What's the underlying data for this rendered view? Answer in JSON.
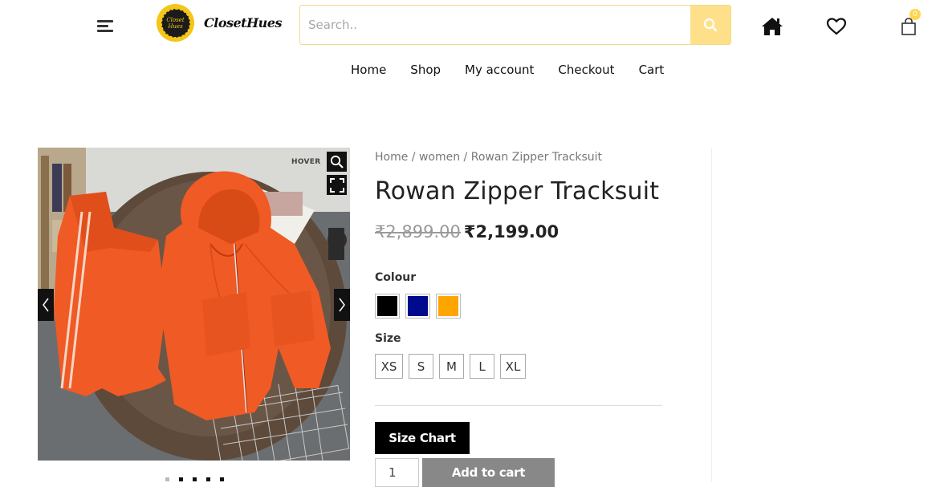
{
  "header": {
    "logo_badge_text": "Closet Hues",
    "logo_text": "ClosetHues",
    "search_placeholder": "Search..",
    "cart_count": "0"
  },
  "nav": {
    "items": [
      {
        "label": "Home"
      },
      {
        "label": "Shop"
      },
      {
        "label": "My account"
      },
      {
        "label": "Checkout"
      },
      {
        "label": "Cart"
      }
    ]
  },
  "gallery": {
    "hover_label": "HOVER",
    "image_subject": "orange zip-up hoodie and jogger tracksuit laid flat",
    "slides_total": 5,
    "active_slide": 1
  },
  "product": {
    "breadcrumb": {
      "home": "Home",
      "sep1": " / ",
      "category": "women",
      "sep2": " / ",
      "current": "Rowan Zipper Tracksuit"
    },
    "title": "Rowan Zipper Tracksuit",
    "price_old": "₹2,899.00",
    "price_new": "₹2,199.00",
    "colour_label": "Colour",
    "colours": [
      "#000000",
      "#000a8c",
      "#ffa500"
    ],
    "size_label": "Size",
    "sizes": [
      "XS",
      "S",
      "M",
      "L",
      "XL"
    ],
    "size_chart_label": "Size Chart",
    "quantity": "1",
    "add_to_cart_label": "Add to cart"
  },
  "colors": {
    "accent_yellow": "#ffe08a",
    "button_dark": "#000000",
    "button_disabled": "#888888"
  }
}
